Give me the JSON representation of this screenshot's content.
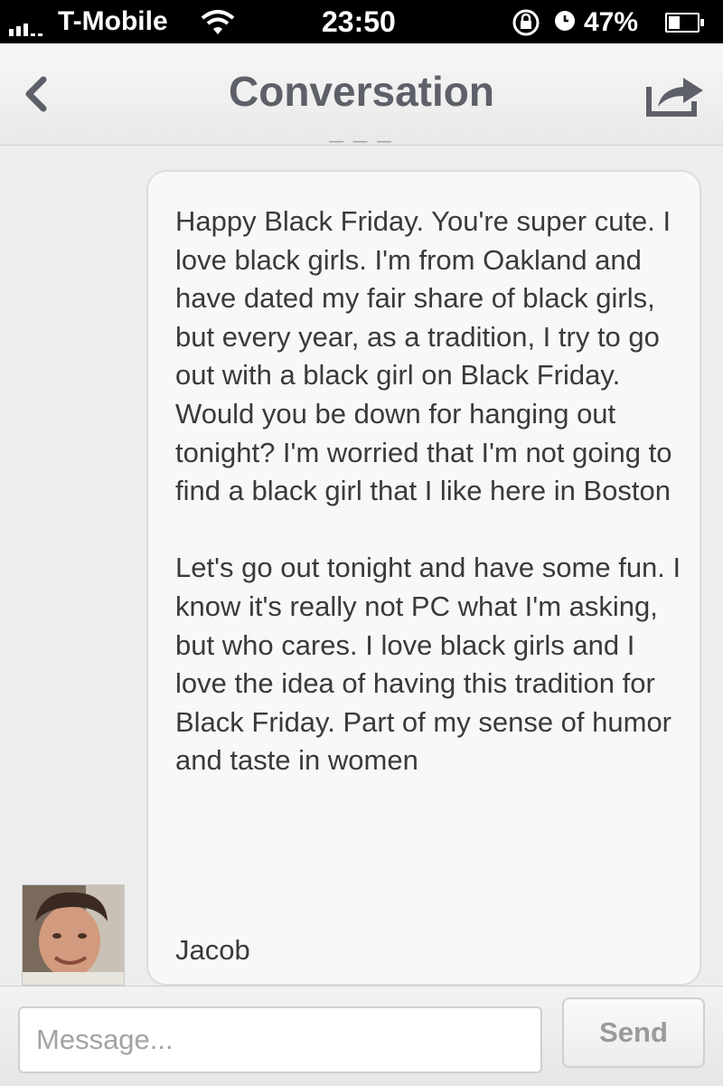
{
  "status_bar": {
    "carrier": "T-Mobile",
    "time": "23:50",
    "battery_percent": "47%",
    "battery_level": 0.47,
    "icons": [
      "signal-icon",
      "wifi-icon",
      "rotation-lock-icon",
      "alarm-icon",
      "battery-icon"
    ]
  },
  "nav": {
    "title": "Conversation",
    "back_icon": "chevron-left-icon",
    "share_icon": "share-icon"
  },
  "message": {
    "body": "Happy Black Friday. You're super cute. I love black girls. I'm from Oakland and have dated my fair share of black girls, but every year, as a tradition, I try to go out with a black girl on Black Friday. Would you be down for hanging out tonight? I'm worried that I'm not going to find a black girl that I like here in Boston\n\nLet's go out tonight and have some fun. I know it's really not PC what I'm asking, but who cares. I love black girls and I love the idea of having this tradition for Black Friday. Part of my sense of humor and taste in women",
    "signature": "Jacob"
  },
  "composer": {
    "placeholder": "Message...",
    "send_label": "Send"
  }
}
